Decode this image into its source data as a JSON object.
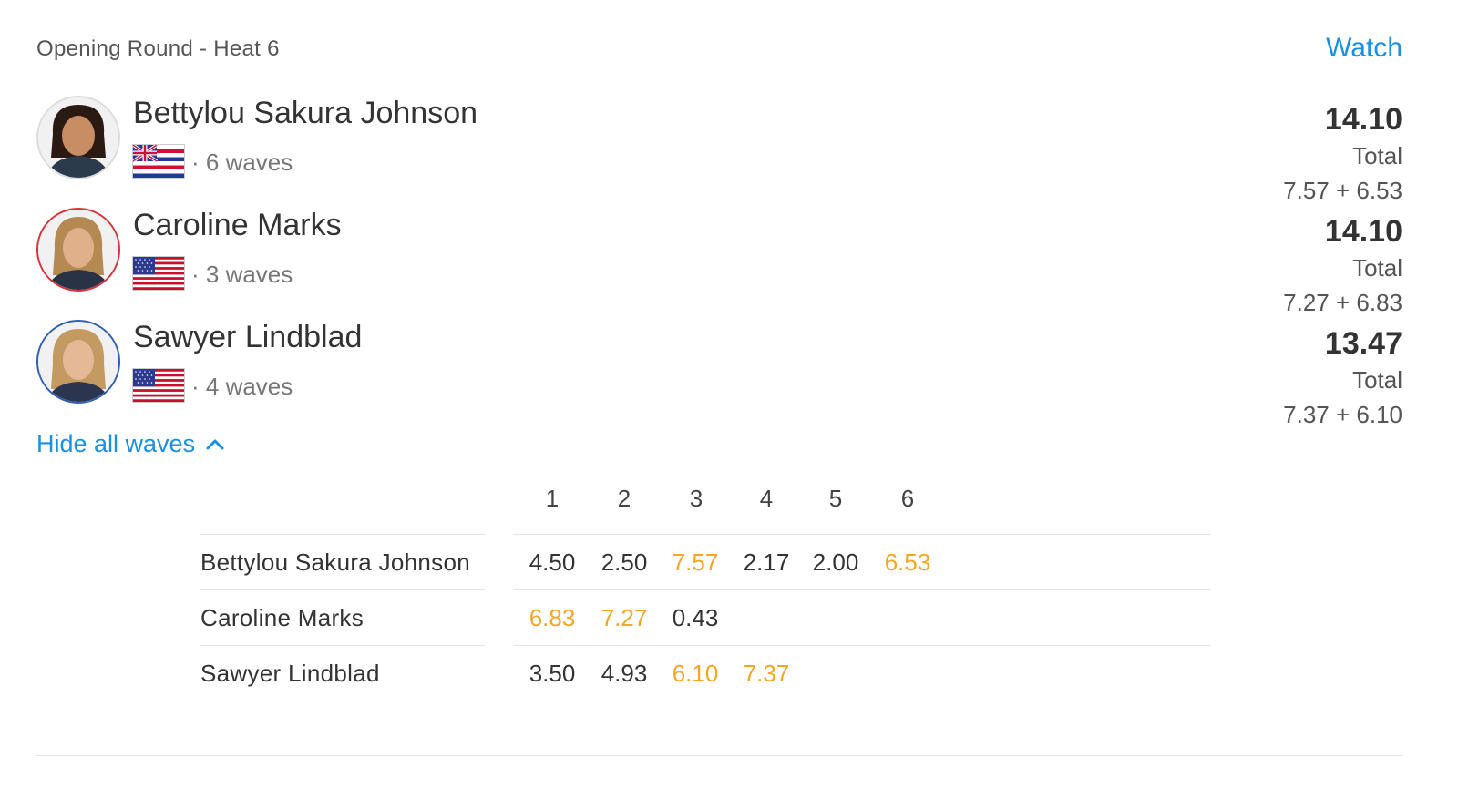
{
  "header": {
    "title": "Opening Round - Heat 6",
    "watch_label": "Watch"
  },
  "athletes": [
    {
      "name": "Bettylou Sakura Johnson",
      "flag": "hawaii-flag-icon",
      "waves_text": "· 6 waves",
      "total": "14.10",
      "total_label": "Total",
      "best_two": "7.57 + 6.53",
      "ring_color": "#dddddd"
    },
    {
      "name": "Caroline Marks",
      "flag": "usa-flag-icon",
      "waves_text": "· 3 waves",
      "total": "14.10",
      "total_label": "Total",
      "best_two": "7.27 + 6.83",
      "ring_color": "#d8333a"
    },
    {
      "name": "Sawyer Lindblad",
      "flag": "usa-flag-icon",
      "waves_text": "· 4 waves",
      "total": "13.47",
      "total_label": "Total",
      "best_two": "7.37 + 6.10",
      "ring_color": "#2f5fb3"
    }
  ],
  "toggle": {
    "label": "Hide all waves",
    "icon": "chevron-up-icon"
  },
  "wave_table": {
    "columns": [
      "1",
      "2",
      "3",
      "4",
      "5",
      "6"
    ],
    "rows": [
      {
        "name": "Bettylou Sakura Johnson",
        "scores": [
          "4.50",
          "2.50",
          "7.57",
          "2.17",
          "2.00",
          "6.53"
        ],
        "best": [
          2,
          5
        ]
      },
      {
        "name": "Caroline Marks",
        "scores": [
          "6.83",
          "7.27",
          "0.43"
        ],
        "best": [
          0,
          1
        ]
      },
      {
        "name": "Sawyer Lindblad",
        "scores": [
          "3.50",
          "4.93",
          "6.10",
          "7.37"
        ],
        "best": [
          2,
          3
        ]
      }
    ]
  },
  "colors": {
    "accent": "#1a8fe3",
    "counting_wave": "#f5a623"
  }
}
